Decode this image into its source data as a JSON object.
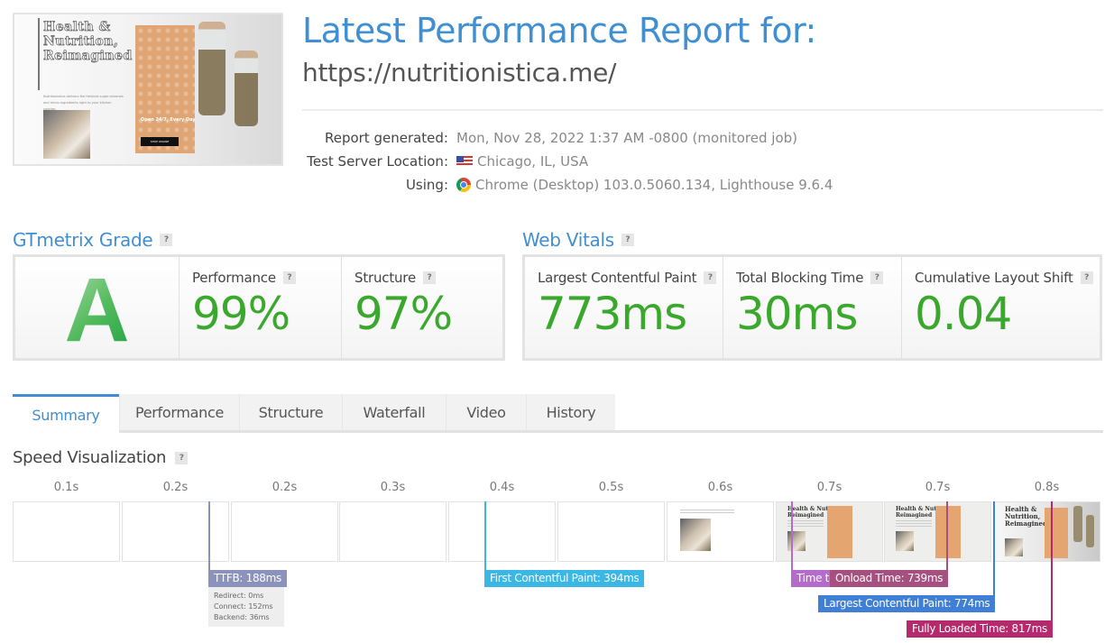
{
  "thumbnail": {
    "headline": "Health &\nNutrition,\nReimagined",
    "blurb": "Nutritionistica delivers the freshest super-minerals and micro-ingredients right to your kitchen counter.",
    "open_text": "Open 24/7, Every Day",
    "shop_button": "SHOP ONLINE"
  },
  "header": {
    "title": "Latest Performance Report for:",
    "url": "https://nutritionistica.me/"
  },
  "meta": [
    {
      "key": "Report generated:",
      "value": "Mon, Nov 28, 2022 1:37 AM -0800 (monitored job)",
      "icon": null
    },
    {
      "key": "Test Server Location:",
      "value": "Chicago, IL, USA",
      "icon": "us-flag-icon"
    },
    {
      "key": "Using:",
      "value": "Chrome (Desktop) 103.0.5060.134, Lighthouse 9.6.4",
      "icon": "chrome-icon"
    }
  ],
  "grade": {
    "heading": "GTmetrix Grade",
    "letter": "A",
    "performance_label": "Performance",
    "performance_value": "99%",
    "structure_label": "Structure",
    "structure_value": "97%"
  },
  "vitals": {
    "heading": "Web Vitals",
    "items": [
      {
        "label": "Largest Contentful Paint",
        "value": "773ms"
      },
      {
        "label": "Total Blocking Time",
        "value": "30ms"
      },
      {
        "label": "Cumulative Layout Shift",
        "value": "0.04"
      }
    ]
  },
  "help_glyph": "?",
  "tabs": [
    "Summary",
    "Performance",
    "Structure",
    "Waterfall",
    "Video",
    "History"
  ],
  "active_tab": "Summary",
  "speed": {
    "heading": "Speed Visualization",
    "frames": [
      {
        "time": "0.1s",
        "content": "blank"
      },
      {
        "time": "0.2s",
        "content": "blank"
      },
      {
        "time": "0.2s",
        "content": "blank"
      },
      {
        "time": "0.3s",
        "content": "blank"
      },
      {
        "time": "0.4s",
        "content": "blank"
      },
      {
        "time": "0.5s",
        "content": "blank"
      },
      {
        "time": "0.6s",
        "content": "partial"
      },
      {
        "time": "0.7s",
        "content": "layout"
      },
      {
        "time": "0.7s",
        "content": "layout"
      },
      {
        "time": "0.8s",
        "content": "full"
      }
    ],
    "markers": {
      "ttfb": {
        "label": "TTFB: 188ms",
        "ms": 188,
        "color": "#8b93bd"
      },
      "fcp": {
        "label": "First Contentful Paint: 394ms",
        "ms": 394,
        "color": "#3bb7e6"
      },
      "tti": {
        "label": "Time to Interactive: 623ms",
        "ms": 623,
        "color": "#b56bcb"
      },
      "onload": {
        "label": "Onload Time: 739ms",
        "ms": 739,
        "color": "#a6507f"
      },
      "lcp": {
        "label": "Largest Contentful Paint: 774ms",
        "ms": 774,
        "color": "#3f7fd6"
      },
      "fully": {
        "label": "Fully Loaded Time: 817ms",
        "ms": 817,
        "color": "#b52a6d"
      }
    },
    "ttfb_breakdown": [
      "Redirect: 0ms",
      "Connect: 152ms",
      "Backend: 36ms"
    ]
  },
  "colors": {
    "accent": "#3f8fd2",
    "good": "#3aa82c"
  }
}
